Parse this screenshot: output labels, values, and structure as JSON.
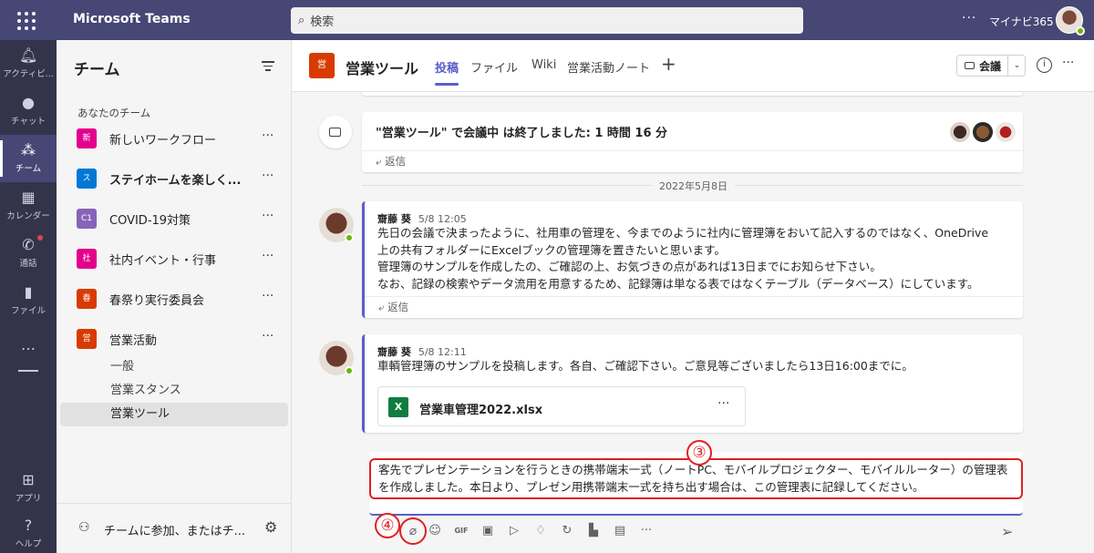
{
  "app": {
    "title": "Microsoft Teams",
    "search_placeholder": "検索",
    "user_name": "マイナビ365"
  },
  "rail": {
    "items": [
      {
        "label": "アクティビ...",
        "icon": "bell-icon"
      },
      {
        "label": "チャット",
        "icon": "chat-icon"
      },
      {
        "label": "チーム",
        "icon": "teams-icon",
        "active": true
      },
      {
        "label": "カレンダー",
        "icon": "calendar-icon"
      },
      {
        "label": "通話",
        "icon": "phone-icon"
      },
      {
        "label": "ファイル",
        "icon": "file-icon"
      }
    ],
    "more": "…",
    "apps": "アプリ",
    "help": "ヘルプ"
  },
  "panel": {
    "title": "チーム",
    "section": "あなたのチーム",
    "teams": [
      {
        "tile": "新",
        "name": "新しいワークフロー",
        "color": "#e3008c"
      },
      {
        "tile": "ス",
        "name": "ステイホームを楽しく...",
        "color": "#0078d4",
        "bold": true
      },
      {
        "tile": "C1",
        "name": "COVID-19対策",
        "color": "#8764b8"
      },
      {
        "tile": "社",
        "name": "社内イベント・行事",
        "color": "#e3008c"
      },
      {
        "tile": "春",
        "name": "春祭り実行委員会",
        "color": "#d83b01"
      },
      {
        "tile": "営",
        "name": "営業活動",
        "color": "#d83b01"
      }
    ],
    "channels": [
      "一般",
      "営業スタンス",
      "営業ツール"
    ],
    "join_label": "チームに参加、またはチ..."
  },
  "header": {
    "tile": "営",
    "name": "営業ツール",
    "tabs": [
      "投稿",
      "ファイル",
      "Wiki",
      "営業活動ノート"
    ],
    "meet_label": "会議"
  },
  "feed": {
    "meeting_text": "\"営業ツール\" で会議中 は終了しました: 1 時間 16 分",
    "reply_label": "返信",
    "date_divider": "2022年5月8日",
    "messages": [
      {
        "author": "齋藤 葵",
        "time": "5/8 12:05",
        "body": "先日の会議で決まったように、社用車の管理を、今までのように社内に管理簿をおいて記入するのではなく、OneDrive\n上の共有フォルダーにExcelブックの管理簿を置きたいと思います。\n管理簿のサンプルを作成したの、ご確認の上、お気づきの点があれば13日までにお知らせ下さい。\nなお、記録の検索やデータ流用を用意するため、記録簿は単なる表ではなくテーブル（データベース）にしています。"
      },
      {
        "author": "齋藤 葵",
        "time": "5/8 12:11",
        "body": "車輌管理簿のサンプルを投稿します。各自、ご確認下さい。ご意見等ございましたら13日16:00までに。",
        "attachment": "営業車管理2022.xlsx"
      }
    ]
  },
  "composer": {
    "text": "客先でプレゼンテーションを行うときの携帯端末一式（ノートPC、モバイルプロジェクター、モバイルルーター）の管理表を作成しました。本日より、プレゼン用携帯端末一式を持ち出す場合は、この管理表に記録してください。",
    "marker_3": "③",
    "marker_4": "④"
  }
}
